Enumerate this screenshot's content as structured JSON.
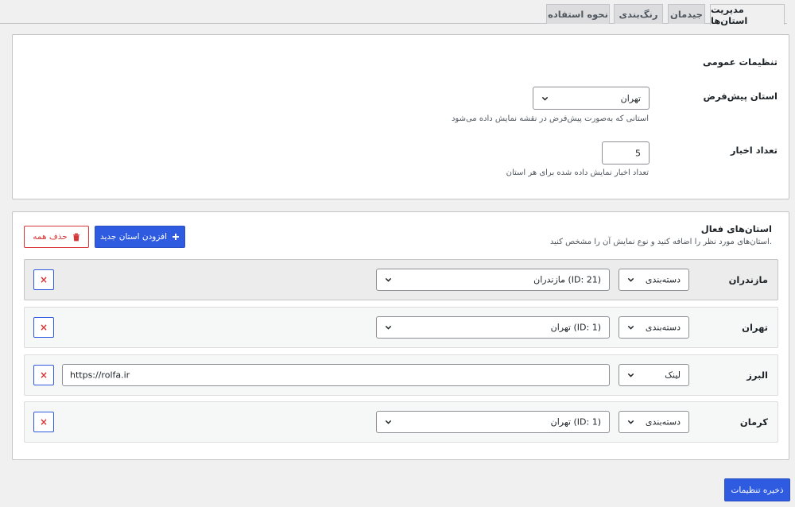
{
  "tabs": [
    {
      "label": "مدیریت استان‌ها",
      "active": true
    },
    {
      "label": "جیدمان",
      "active": false
    },
    {
      "label": "رنگ‌بندی",
      "active": false
    },
    {
      "label": "نحوه استفاده",
      "active": false
    }
  ],
  "general": {
    "title": "تنظیمات عمومی",
    "default_province": {
      "label": "استان پیش‌فرض",
      "value": "تهران",
      "description": "استانی که به‌صورت پیش‌فرض در نقشه نمایش داده می‌شود"
    },
    "news_count": {
      "label": "تعداد اخبار",
      "value": "5",
      "description": "تعداد اخبار نمایش داده شده برای هر استان"
    }
  },
  "active": {
    "title": "استان‌های فعال",
    "subtitle": "استان‌های مورد نظر را اضافه کنید و نوع نمایش آن را مشخص کنید.",
    "add_button": "افزودن استان جدید",
    "delete_all_button": "حذف همه",
    "rows": [
      {
        "name": "مازندران",
        "type": "دسته‌بندی",
        "value": "مازندران (ID: 21)"
      },
      {
        "name": "تهران",
        "type": "دسته‌بندی",
        "value": "تهران (ID: 1)"
      },
      {
        "name": "البرز",
        "type": "لینک",
        "value": "https://rolfa.ir"
      },
      {
        "name": "کرمان",
        "type": "دسته‌بندی",
        "value": "تهران (ID: 1)"
      }
    ],
    "remove_glyph": "×"
  },
  "save_button": "ذخیره تنظیمات",
  "icons": {
    "chevron": "chevron-down-icon",
    "plus": "plus-icon",
    "trash": "trash-icon",
    "remove": "close-icon"
  },
  "colors": {
    "primary": "#2f5be0",
    "danger": "#d63638"
  }
}
